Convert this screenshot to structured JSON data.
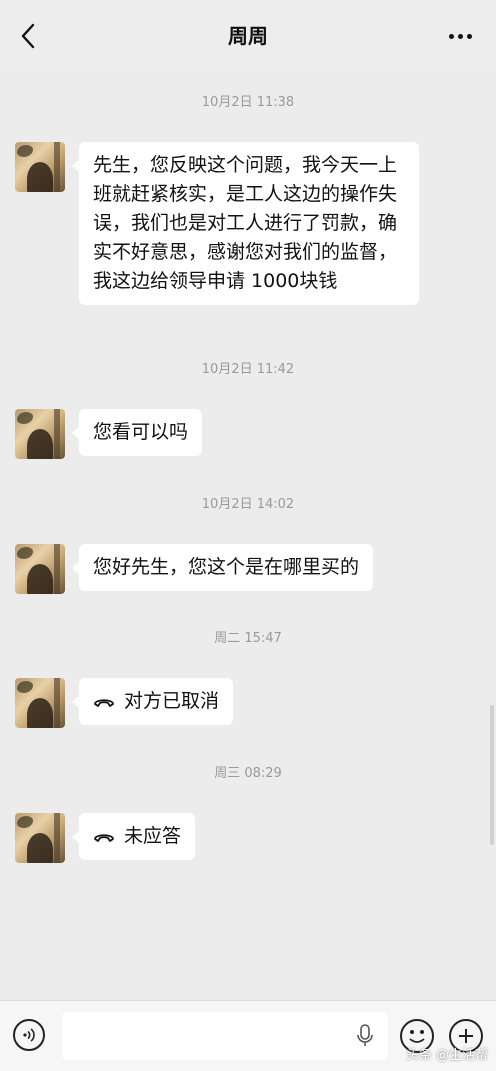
{
  "header": {
    "title": "周周",
    "back_icon": "chevron-left-icon",
    "more_icon": "more-dots-icon"
  },
  "messages": [
    {
      "timestamp": "10月2日 11:38",
      "text": "先生，您反映这个问题，我今天一上班就赶紧核实，是工人这边的操作失误，我们也是对工人进行了罚款，确实不好意思，感谢您对我们的监督，我这边给领导申请 1000块钱"
    },
    {
      "timestamp": "10月2日 11:42",
      "text": "您看可以吗"
    },
    {
      "timestamp": "10月2日 14:02",
      "text": "您好先生，您这个是在哪里买的"
    },
    {
      "timestamp": "周二 15:47",
      "call_text": "对方已取消",
      "call_icon": "phone-hangup-icon"
    },
    {
      "timestamp": "周三 08:29",
      "call_text": "未应答",
      "call_icon": "phone-hangup-icon"
    }
  ],
  "input_bar": {
    "voice_icon": "voice-icon",
    "mic_icon": "mic-icon",
    "emoji_icon": "emoji-icon",
    "plus_icon": "plus-icon"
  },
  "watermark": "头条 @生活帮"
}
